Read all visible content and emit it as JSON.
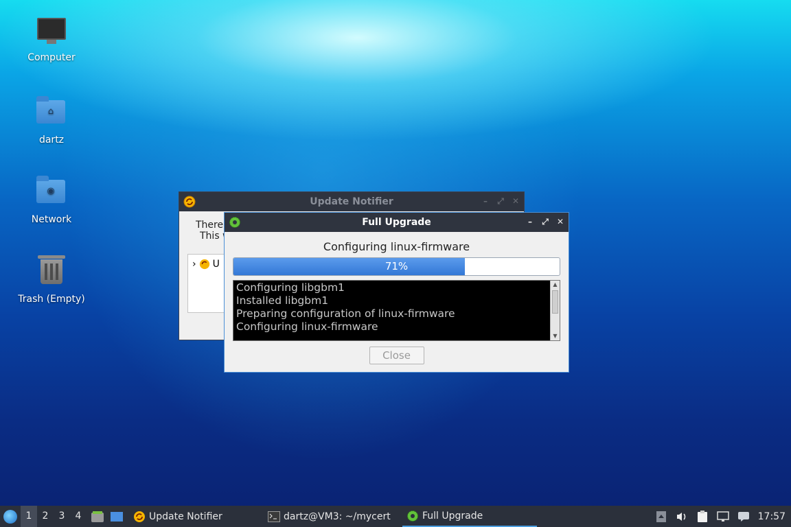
{
  "desktop": {
    "icons": [
      {
        "label": "Computer",
        "icon": "computer-icon"
      },
      {
        "label": "dartz",
        "icon": "home-folder-icon"
      },
      {
        "label": "Network",
        "icon": "network-folder-icon"
      },
      {
        "label": "Trash (Empty)",
        "icon": "trash-icon"
      }
    ]
  },
  "update_notifier": {
    "title": "Update Notifier",
    "text_line1": "There",
    "text_line2": "This w",
    "tree_item": "U"
  },
  "full_upgrade": {
    "title": "Full Upgrade",
    "status": "Configuring linux-firmware",
    "progress_fraction": 0.71,
    "progress_label": "71%",
    "log": [
      "Configuring libgbm1",
      "Installed libgbm1",
      "Preparing configuration of linux-firmware",
      "Configuring linux-firmware"
    ],
    "close_label": "Close"
  },
  "taskbar": {
    "workspaces": [
      "1",
      "2",
      "3",
      "4"
    ],
    "tasks": [
      {
        "label": "Update Notifier",
        "icon": "update-notifier-icon"
      },
      {
        "label": "dartz@VM3: ~/mycert",
        "icon": "terminal-icon"
      },
      {
        "label": "Full Upgrade",
        "icon": "gear-icon"
      }
    ],
    "clock": "17:57"
  },
  "colors": {
    "titlebar": "#2f343f",
    "progress_fill": "#3378d6",
    "taskbar": "#2b303b"
  }
}
